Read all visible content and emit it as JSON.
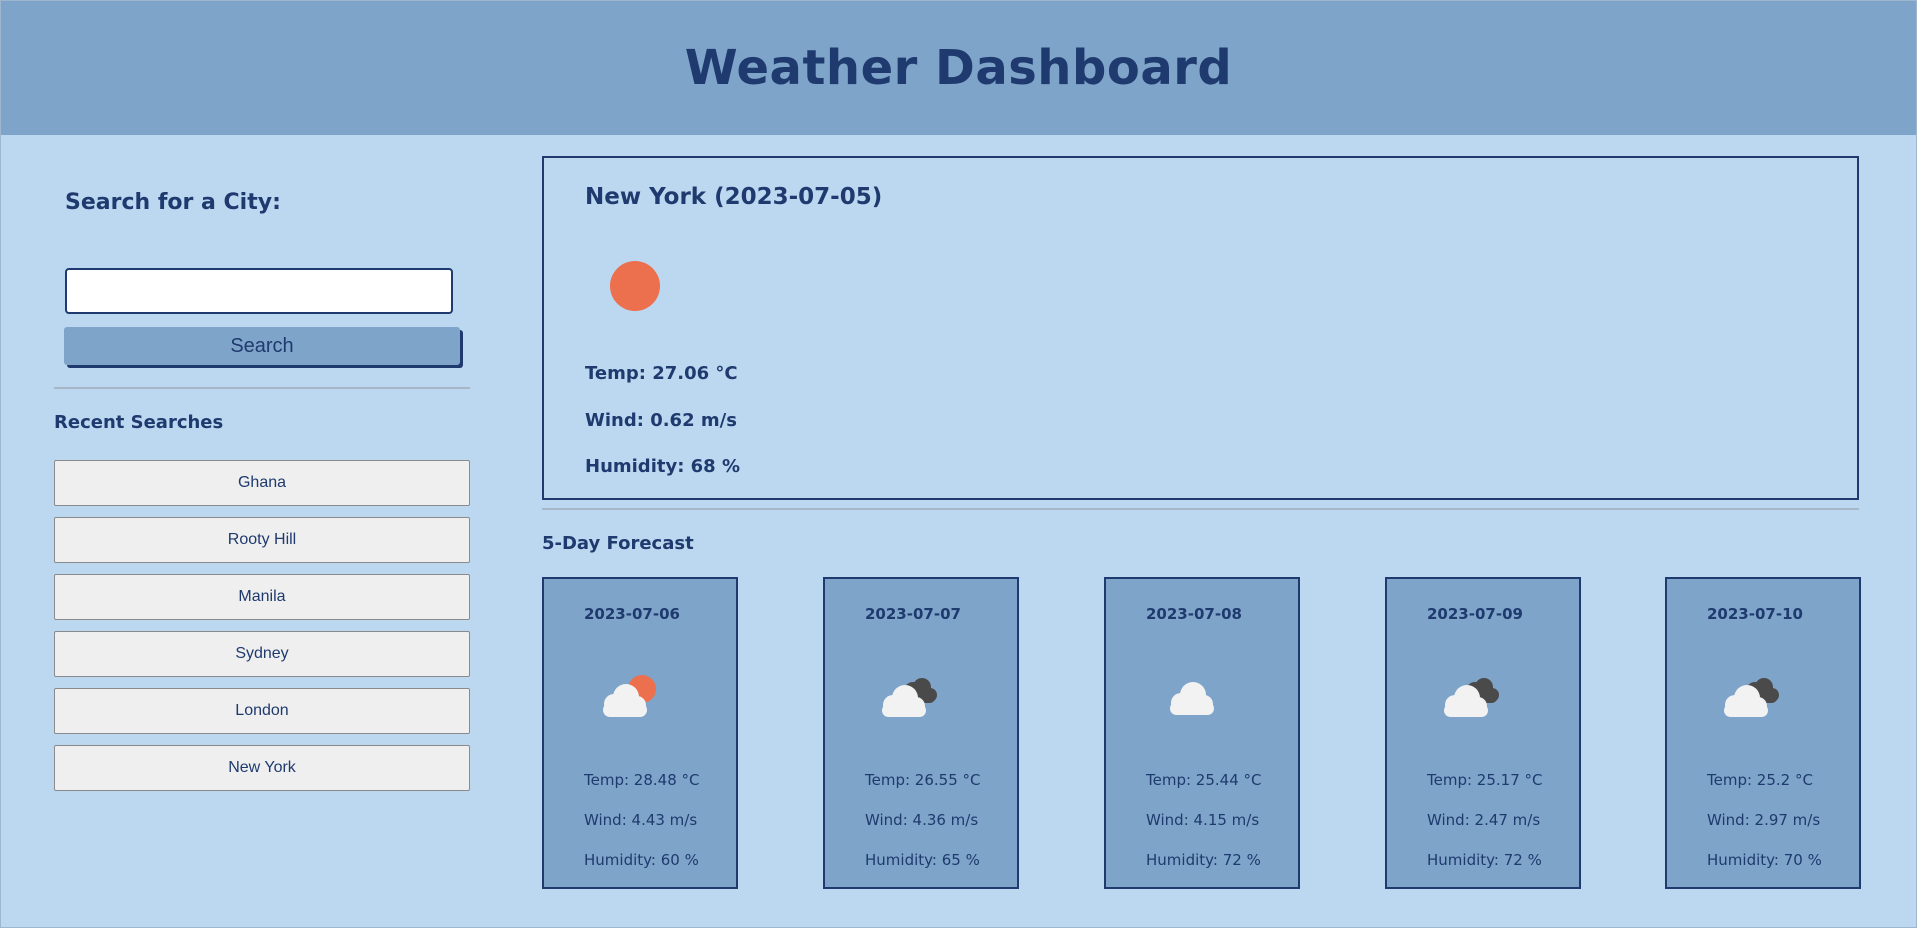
{
  "header": {
    "title": "Weather Dashboard"
  },
  "search": {
    "heading": "Search for a City:",
    "value": "",
    "button_label": "Search"
  },
  "recent": {
    "heading": "Recent Searches",
    "items": [
      "Ghana",
      "Rooty Hill",
      "Manila",
      "Sydney",
      "London",
      "New York"
    ]
  },
  "current": {
    "title": "New York (2023-07-05)",
    "icon": "sun-icon",
    "temp": "Temp: 27.06 °C",
    "wind": "Wind: 0.62 m/s",
    "humidity": "Humidity: 68 %"
  },
  "forecast": {
    "heading": "5-Day Forecast",
    "days": [
      {
        "date": "2023-07-06",
        "icon": "partly-sunny-icon",
        "temp": "Temp: 28.48 °C",
        "wind": "Wind: 4.43 m/s",
        "humidity": "Humidity: 60 %"
      },
      {
        "date": "2023-07-07",
        "icon": "broken-clouds-icon",
        "temp": "Temp: 26.55 °C",
        "wind": "Wind: 4.36 m/s",
        "humidity": "Humidity: 65 %"
      },
      {
        "date": "2023-07-08",
        "icon": "cloud-icon",
        "temp": "Temp: 25.44 °C",
        "wind": "Wind: 4.15 m/s",
        "humidity": "Humidity: 72 %"
      },
      {
        "date": "2023-07-09",
        "icon": "broken-clouds-icon",
        "temp": "Temp: 25.17 °C",
        "wind": "Wind: 2.47 m/s",
        "humidity": "Humidity: 72 %"
      },
      {
        "date": "2023-07-10",
        "icon": "broken-clouds-icon",
        "temp": "Temp: 25.2 °C",
        "wind": "Wind: 2.97 m/s",
        "humidity": "Humidity: 70 %"
      }
    ]
  },
  "colors": {
    "header_bg": "#7fa4ca",
    "page_bg": "#bcd8f0",
    "text": "#1e3a6e",
    "sun": "#ec6f4e",
    "dark_cloud": "#4a4a4a",
    "light_cloud": "#f2f2f2"
  }
}
